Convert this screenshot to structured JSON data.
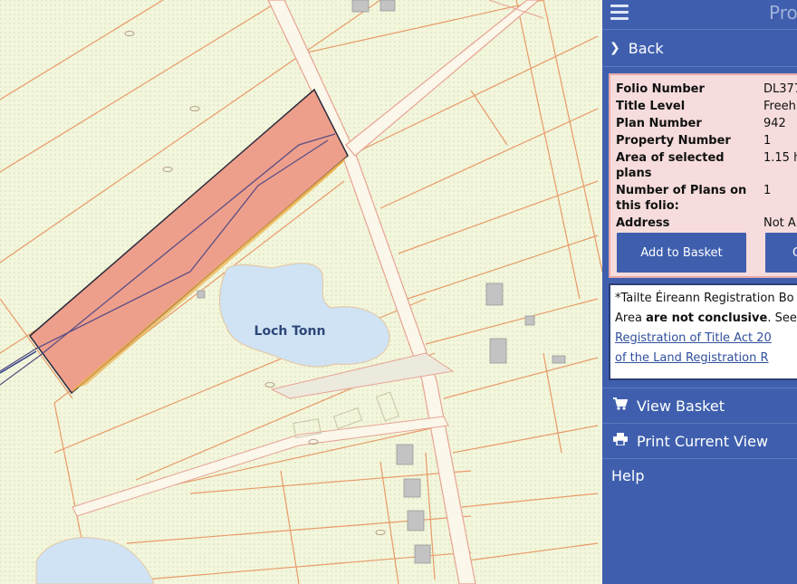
{
  "map": {
    "lake_label": "Loch Tonn",
    "colors": {
      "background": "#f3f6dc",
      "water": "#cfe3f5",
      "parcel": "#ee9f8c",
      "parcel_edge": "#e8a93a",
      "boundary": "#e89a6a"
    }
  },
  "panel": {
    "top_title": "Pro",
    "back_label": "Back",
    "info": {
      "rows": [
        {
          "label": "Folio Number",
          "value": "DL377"
        },
        {
          "label": "Title Level",
          "value": "Freeh"
        },
        {
          "label": "Plan Number",
          "value": "942"
        },
        {
          "label": "Property Number",
          "value": "1"
        },
        {
          "label": "Area of selected plans",
          "value": "1.15 h"
        },
        {
          "label": "Number of Plans on this folio:",
          "value": "1"
        },
        {
          "label": "Address",
          "value": "Not A"
        }
      ],
      "add_to_basket_label": "Add to Basket",
      "second_button_label": "C"
    },
    "notice": {
      "line1": "*Tailte Éireann Registration Bo",
      "line2_prefix": "Area ",
      "line2_bold": "are not conclusive",
      "line2_suffix": ". See",
      "link1": "Registration of Title Act 20",
      "link2": "of the Land Registration R"
    },
    "menu": {
      "view_basket": "View Basket",
      "print_view": "Print Current View",
      "help": "Help"
    },
    "colors": {
      "panel_bg": "#3f5fae",
      "info_bg": "#f6dcdc"
    }
  }
}
